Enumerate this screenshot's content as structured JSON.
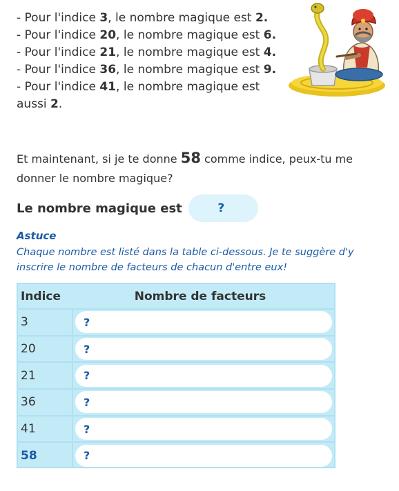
{
  "clues": [
    {
      "prefix": "- Pour l'indice ",
      "index": "3",
      "middle": ", le nombre magique est ",
      "value": "2.",
      "suffix": ""
    },
    {
      "prefix": "- Pour l'indice ",
      "index": "20",
      "middle": ", le nombre magique est ",
      "value": "6.",
      "suffix": ""
    },
    {
      "prefix": "- Pour l'indice ",
      "index": "21",
      "middle": ", le nombre magique est ",
      "value": "4.",
      "suffix": ""
    },
    {
      "prefix": "- Pour l'indice ",
      "index": "36",
      "middle": ", le nombre magique est ",
      "value": "9.",
      "suffix": ""
    },
    {
      "prefix": "- Pour l'indice ",
      "index": "41",
      "middle": ", le nombre magique est aussi ",
      "value": "2",
      "suffix": "."
    }
  ],
  "question": {
    "before": "Et maintenant, si je te donne ",
    "number": "58",
    "after": " comme indice, peux-tu me donner le nombre magique?"
  },
  "answer": {
    "label": "Le nombre magique est",
    "value": "?"
  },
  "tip": {
    "title": "Astuce",
    "text": "Chaque nombre est listé dans la table ci-dessous. Je te suggère d'y inscrire le nombre de facteurs de chacun d'entre eux!"
  },
  "table": {
    "headers": {
      "index": "Indice",
      "factors": "Nombre de facteurs"
    },
    "rows": [
      {
        "index": "3",
        "value": "?"
      },
      {
        "index": "20",
        "value": "?"
      },
      {
        "index": "21",
        "value": "?"
      },
      {
        "index": "36",
        "value": "?"
      },
      {
        "index": "41",
        "value": "?"
      },
      {
        "index": "58",
        "value": "?"
      }
    ]
  },
  "colors": {
    "accent": "#1b5aa6",
    "field_bg": "#def4fc",
    "table_bg": "#c3ebf7"
  },
  "illustration": {
    "icon": "snake-charmer-icon"
  }
}
